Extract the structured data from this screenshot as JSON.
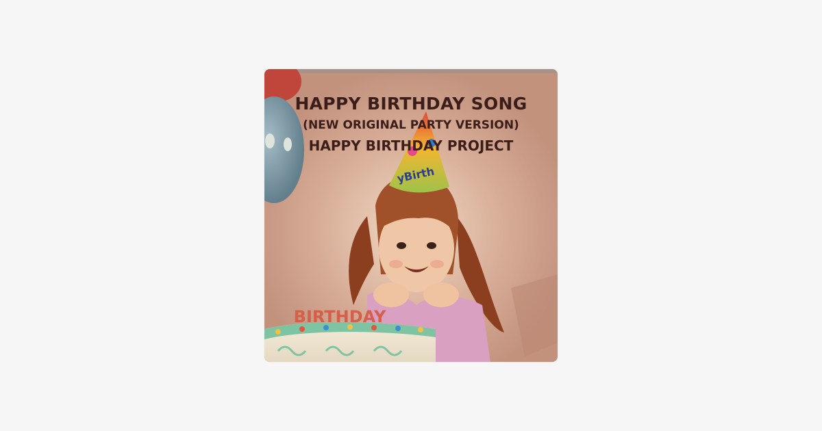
{
  "page": {
    "background_color": "#f6f6f6"
  },
  "artwork": {
    "line1": "HAPPY BIRTHDAY SONG",
    "line2": "(NEW ORIGINAL PARTY VERSION)",
    "line3": "HAPPY BIRTHDAY PROJECT",
    "hat_text": "yBirth",
    "cake_text": "BIRTHDAY",
    "colors": {
      "background": "#c89a85",
      "text": "#3b1e1a",
      "balloon_blue": "#7f9aa6",
      "balloon_red": "#c0453a",
      "hair": "#9a4a24",
      "shirt": "#d9a0c2"
    }
  }
}
